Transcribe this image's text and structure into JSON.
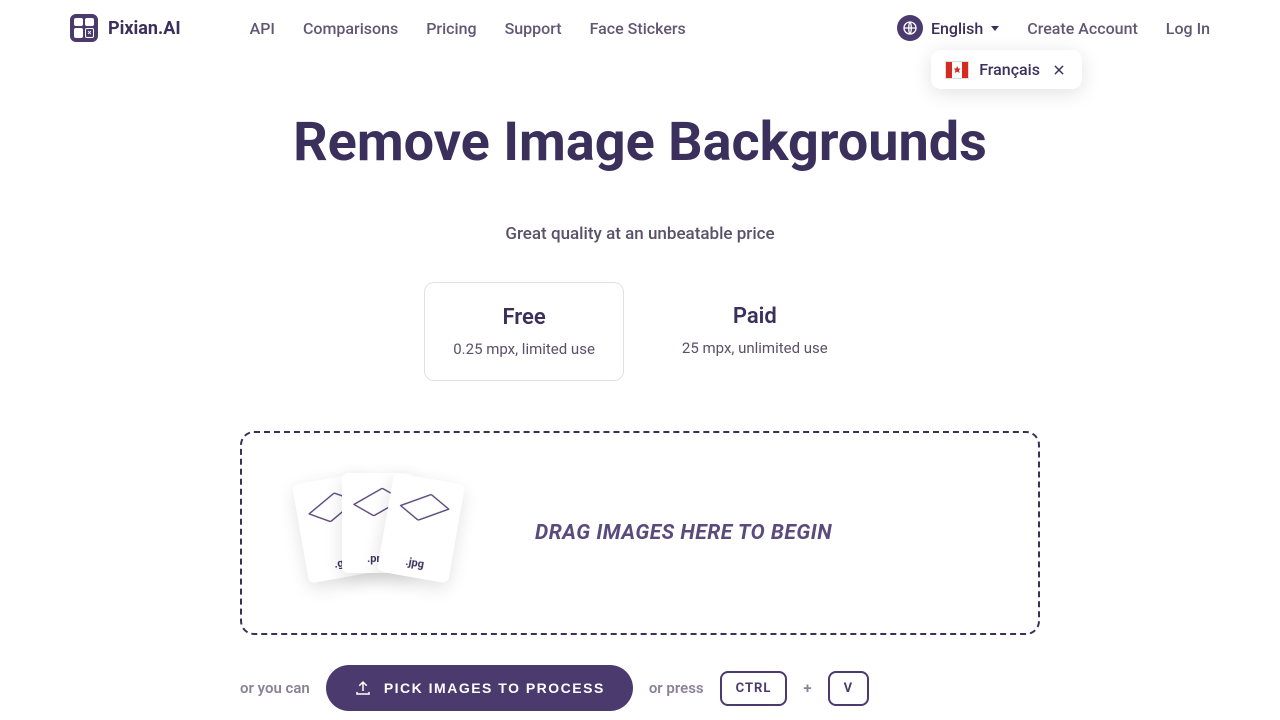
{
  "brand": "Pixian.AI",
  "nav": {
    "api": "API",
    "comparisons": "Comparisons",
    "pricing": "Pricing",
    "support": "Support",
    "face_stickers": "Face Stickers"
  },
  "lang": {
    "current": "English",
    "popup_label": "Français"
  },
  "auth": {
    "create": "Create Account",
    "login": "Log In"
  },
  "hero": {
    "headline": "Remove Image Backgrounds",
    "sub": "Great quality at an unbeatable price"
  },
  "plans": {
    "free": {
      "title": "Free",
      "desc": "0.25 mpx, limited use"
    },
    "paid": {
      "title": "Paid",
      "desc": "25 mpx, unlimited use"
    }
  },
  "dropzone": {
    "drag_text": "DRAG IMAGES HERE TO BEGIN",
    "ext1": ".gif",
    "ext2": ".png",
    "ext3": ".jpg"
  },
  "actions": {
    "or_you_can": "or you can",
    "pick_button": "PICK IMAGES TO PROCESS",
    "or_press": "or press",
    "key_ctrl": "CTRL",
    "plus": "+",
    "key_v": "V"
  }
}
